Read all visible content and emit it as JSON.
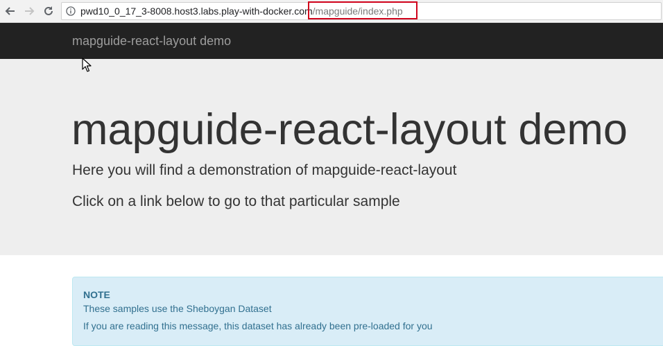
{
  "browser": {
    "url_host": "pwd10_0_17_3-8008.host3.labs.play-with-docker.com",
    "url_path": "/mapguide/index.php",
    "icons": {
      "back": "arrow-left-icon",
      "forward": "arrow-right-icon",
      "reload": "reload-icon",
      "info": "info-icon"
    },
    "highlight_color": "#d0021b"
  },
  "navbar": {
    "brand": "mapguide-react-layout demo"
  },
  "jumbotron": {
    "title": "mapguide-react-layout demo",
    "lead_1": "Here you will find a demonstration of mapguide-react-layout",
    "lead_2": "Click on a link below to go to that particular sample"
  },
  "note": {
    "title": "NOTE",
    "line_1": "These samples use the Sheboygan Dataset",
    "line_2": "If you are reading this message, this dataset has already been pre-loaded for you"
  },
  "colors": {
    "navbar_bg": "#222222",
    "jumbotron_bg": "#eeeeee",
    "alert_bg": "#d9edf7",
    "alert_text": "#31708f"
  }
}
